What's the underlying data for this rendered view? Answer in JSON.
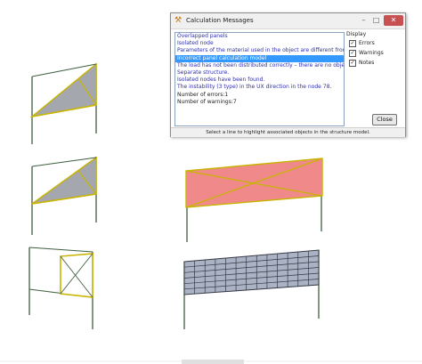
{
  "dialog": {
    "title": "Calculation Messages",
    "title_icon": "app-icon",
    "window_controls": [
      "minimize",
      "maximize",
      "close"
    ],
    "messages": [
      {
        "text": "Overlapped panels",
        "kind": "error"
      },
      {
        "text": "Isolated node",
        "kind": "error"
      },
      {
        "text": "Parameters of the material used in the object are different from parameters c",
        "kind": "error"
      },
      {
        "text": "Incorrect panel calculation model",
        "kind": "error",
        "selected": true
      },
      {
        "text": "The load has not been distributed correctly – there are no objects or element",
        "kind": "error"
      },
      {
        "text": "Separate structure.",
        "kind": "error"
      },
      {
        "text": "Isolated nodes have been found.",
        "kind": "error"
      },
      {
        "text": "The instability (3 type) in the UX direction in the node 78.",
        "kind": "error"
      },
      {
        "text": "Number of errors:1",
        "kind": "info"
      },
      {
        "text": "Number of warnings:7",
        "kind": "info"
      }
    ],
    "display": {
      "label": "Display",
      "options": [
        {
          "label": "Errors",
          "checked": true
        },
        {
          "label": "Warnings",
          "checked": true
        },
        {
          "label": "Notes",
          "checked": true
        }
      ]
    },
    "close_label": "Close",
    "status": "Select a line to highlight associated objects in the structure model."
  },
  "colors": {
    "panel_gray": "#a4a8ae",
    "panel_red": "#f08a8a",
    "panel_edge": "#c8b400",
    "column": "#3f5f3f",
    "mesh_fill": "#aab2c4",
    "mesh_line": "#333845",
    "selected_row": "#3399ff",
    "message_text": "#2f2fb0"
  }
}
